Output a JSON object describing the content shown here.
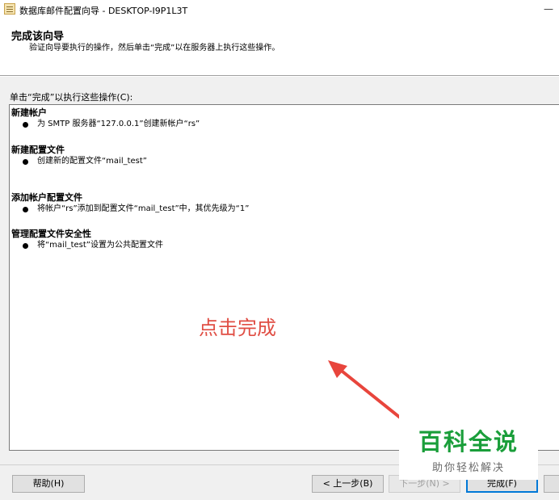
{
  "window": {
    "title": "数据库邮件配置向导 - DESKTOP-I9P1L3T",
    "minimize_glyph": "—"
  },
  "header": {
    "title": "完成该向导",
    "subtitle": "验证向导要执行的操作，然后单击“完成”以在服务器上执行这些操作。"
  },
  "main": {
    "list_caption": "单击“完成”以执行这些操作(C):",
    "groups": [
      {
        "title": "新建帐户",
        "items": [
          "为 SMTP 服务器“127.0.0.1”创建新帐户“rs”"
        ]
      },
      {
        "title": "新建配置文件",
        "items": [
          "创建新的配置文件“mail_test”"
        ]
      },
      {
        "title": "添加帐户配置文件",
        "items": [
          "将帐户“rs”添加到配置文件“mail_test”中，其优先级为“1”"
        ]
      },
      {
        "title": "管理配置文件安全性",
        "items": [
          "将“mail_test”设置为公共配置文件"
        ]
      }
    ]
  },
  "annotation": {
    "text": "点击完成",
    "color": "#e04e44"
  },
  "footer": {
    "help_label": "帮助(H)",
    "back_label": "< 上一步(B)",
    "next_label": "下一步(N) >",
    "finish_label": "完成(F)"
  },
  "watermark": {
    "main": "百科全说",
    "sub": "助你轻松解决"
  },
  "colors": {
    "accent": "#0078d7",
    "watermark_green": "#1a9e3a"
  }
}
